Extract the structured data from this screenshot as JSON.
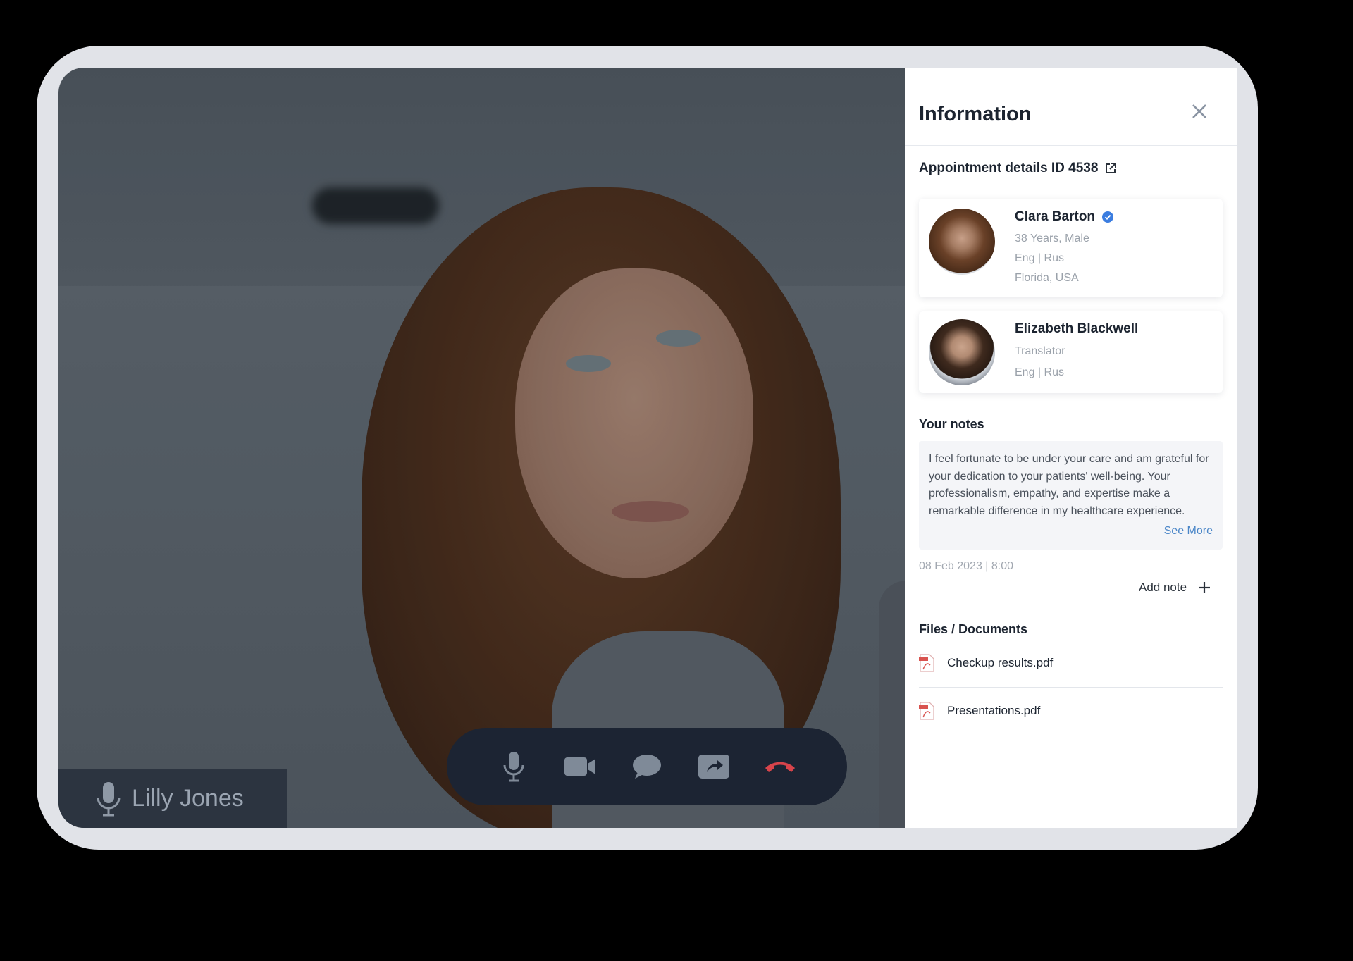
{
  "call": {
    "participant_name": "Lilly Jones",
    "controls": [
      "mic-icon",
      "video-icon",
      "chat-icon",
      "share-icon",
      "hang-up-icon"
    ],
    "hang_up_color": "#d8444b"
  },
  "panel": {
    "title": "Information",
    "appointment_label": "Appointment details ID 4538",
    "patient": {
      "name": "Clara Barton",
      "age_gender": "38 Years, Male",
      "languages": "Eng | Rus",
      "location": "Florida, USA",
      "verified_color": "#3b7de0"
    },
    "translator": {
      "name": "Elizabeth Blackwell",
      "role": "Translator",
      "languages": "Eng | Rus"
    },
    "notes": {
      "title": "Your notes",
      "text": "I feel fortunate to be under your care and am grateful for your dedication to your patients' well-being. Your professionalism, empathy, and expertise make a remarkable difference in my healthcare experience.",
      "see_more": "See More",
      "date": "08 Feb 2023 | 8:00",
      "add_note": "Add note"
    },
    "files": {
      "title": "Files / Documents",
      "items": [
        "Checkup results.pdf",
        "Presentations.pdf"
      ]
    }
  }
}
